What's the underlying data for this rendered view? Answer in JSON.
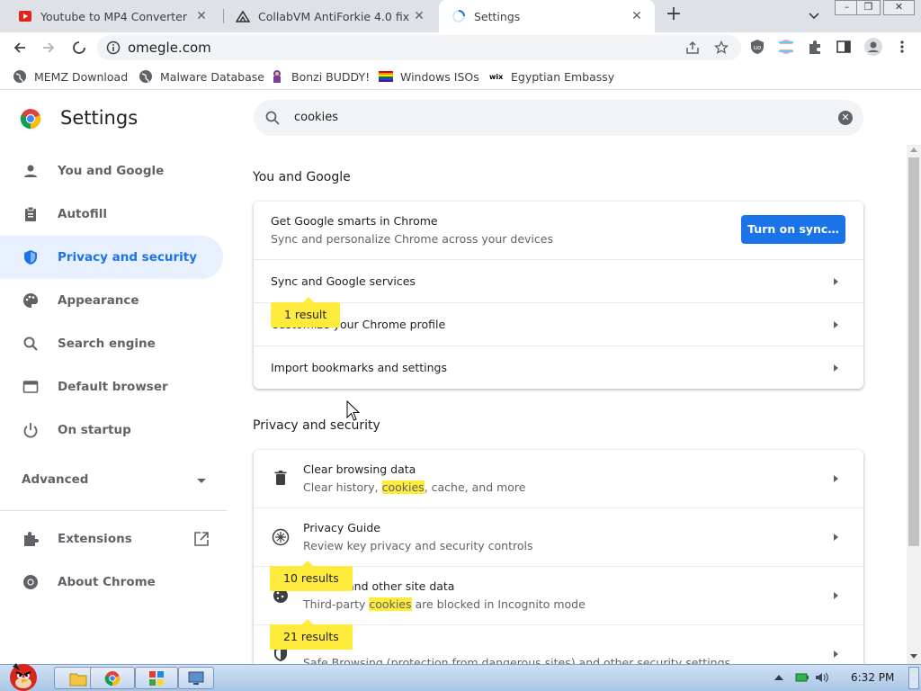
{
  "tabs": [
    {
      "title": "Youtube to MP4 Converter | YT",
      "icon": "youtube-icon"
    },
    {
      "title": "CollabVM AntiForkie 4.0 fix.bat",
      "icon": "collabvm-icon"
    },
    {
      "title": "Settings",
      "icon": "loading-spinner-icon"
    }
  ],
  "window_buttons": {
    "minimize": "–",
    "restore": "❐",
    "close": "✕"
  },
  "address_bar": {
    "url": "omegle.com"
  },
  "bookmarks": [
    {
      "label": "MEMZ Download",
      "icon": "globe-icon"
    },
    {
      "label": "Malware Database",
      "icon": "globe-icon"
    },
    {
      "label": "Bonzi BUDDY!",
      "icon": "bonzi-icon"
    },
    {
      "label": "Windows ISOs",
      "icon": "rainbow-flag-icon"
    },
    {
      "label": "Egyptian Embassy",
      "icon": "wix-icon"
    }
  ],
  "settings": {
    "title": "Settings",
    "search_value": "cookies"
  },
  "sidebar": {
    "items": [
      {
        "label": "You and Google",
        "icon": "person-icon"
      },
      {
        "label": "Autofill",
        "icon": "clipboard-icon"
      },
      {
        "label": "Privacy and security",
        "icon": "shield-icon"
      },
      {
        "label": "Appearance",
        "icon": "palette-icon"
      },
      {
        "label": "Search engine",
        "icon": "search-icon"
      },
      {
        "label": "Default browser",
        "icon": "browser-window-icon"
      },
      {
        "label": "On startup",
        "icon": "power-icon"
      }
    ],
    "advanced": "Advanced",
    "extensions": "Extensions",
    "about": "About Chrome"
  },
  "you_and_google": {
    "heading": "You and Google",
    "smarts_title": "Get Google smarts in Chrome",
    "smarts_sub": "Sync and personalize Chrome across your devices",
    "sync_button": "Turn on sync…",
    "rows": [
      "Sync and Google services",
      "Customize your Chrome profile",
      "Import bookmarks and settings"
    ],
    "bubble": "1 result"
  },
  "privacy": {
    "heading": "Privacy and security",
    "clear_title": "Clear browsing data",
    "clear_sub_a": "Clear history, ",
    "clear_sub_hl": "cookies",
    "clear_sub_b": ", cache, and more",
    "guide_title": "Privacy Guide",
    "guide_sub": "Review key privacy and security controls",
    "cookies_title": "and other site data",
    "cookies_sub_a": "Third-party ",
    "cookies_sub_hl": "cookies",
    "cookies_sub_b": " are blocked in Incognito mode",
    "security_sub": "Safe Browsing (protection from dangerous sites) and other security settings",
    "bubble_cookies": "10 results",
    "bubble_security": "21 results"
  },
  "taskbar": {
    "clock": "6:32 PM"
  },
  "colors": {
    "accent": "#1a73e8",
    "highlight": "#ffeb3b",
    "active_nav_bg": "#e8f0fe"
  }
}
